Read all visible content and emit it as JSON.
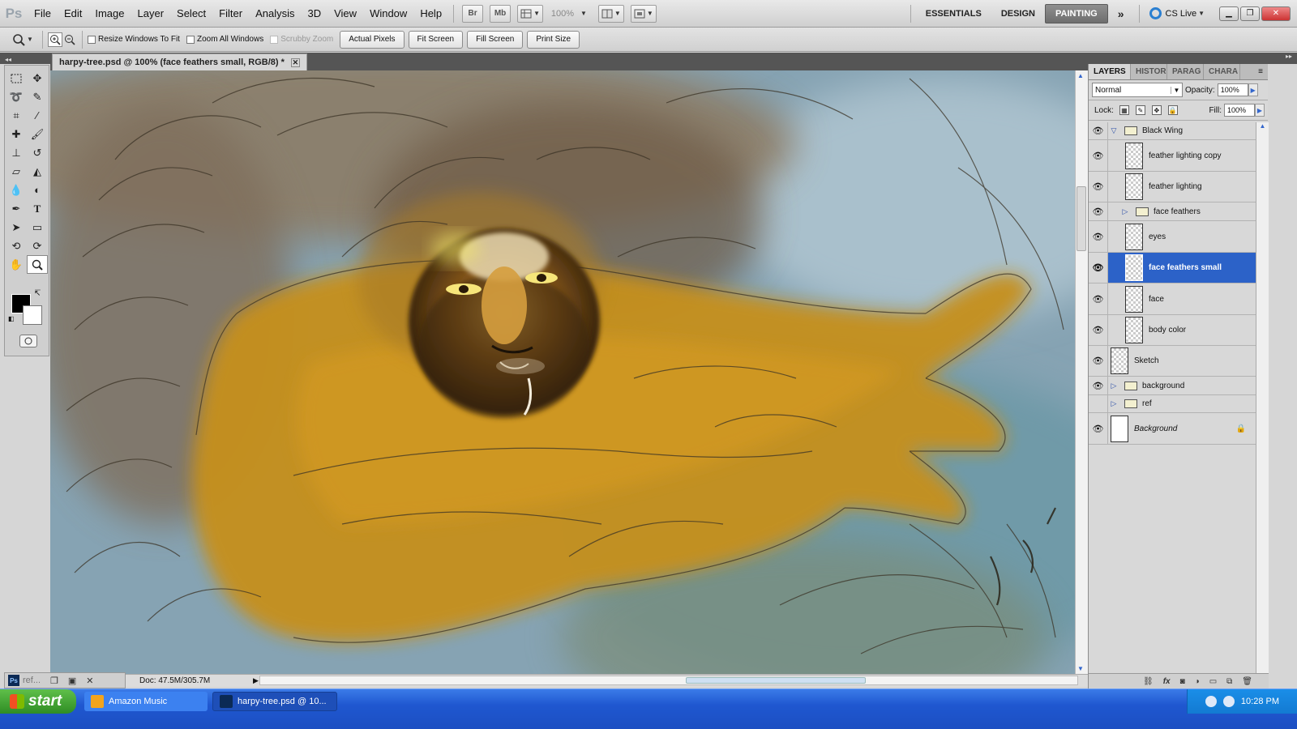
{
  "app": {
    "logo": "Ps"
  },
  "menu": [
    "File",
    "Edit",
    "Image",
    "Layer",
    "Select",
    "Filter",
    "Analysis",
    "3D",
    "View",
    "Window",
    "Help"
  ],
  "appbar": {
    "bridge_label": "Br",
    "minibridge_label": "Mb",
    "zoom": "100%",
    "workspaces": [
      "ESSENTIALS",
      "DESIGN",
      "PAINTING"
    ],
    "active_workspace": "PAINTING",
    "cslive": "CS Live"
  },
  "options": {
    "resize_windows": "Resize Windows To Fit",
    "zoom_all": "Zoom All Windows",
    "scrubby_zoom": "Scrubby Zoom",
    "buttons": [
      "Actual Pixels",
      "Fit Screen",
      "Fill Screen",
      "Print Size"
    ]
  },
  "document": {
    "tab_title": "harpy-tree.psd @ 100% (face feathers small, RGB/8) *",
    "doc_size": "Doc: 47.5M/305.7M",
    "minimized_title": "ref..."
  },
  "layers_panel": {
    "tabs": [
      "LAYERS",
      "HISTOR",
      "PARAG",
      "CHARA"
    ],
    "blend_mode": "Normal",
    "opacity_label": "Opacity:",
    "opacity": "100%",
    "lock_label": "Lock:",
    "fill_label": "Fill:",
    "fill": "100%",
    "layers": [
      {
        "name": "Black Wing",
        "type": "group",
        "expanded": true,
        "indent": 0,
        "visible": true
      },
      {
        "name": "feather lighting copy",
        "type": "layer",
        "indent": 1,
        "visible": true
      },
      {
        "name": "feather lighting",
        "type": "layer",
        "indent": 1,
        "visible": true
      },
      {
        "name": "face feathers",
        "type": "group",
        "expanded": false,
        "indent": 1,
        "visible": true
      },
      {
        "name": "eyes",
        "type": "layer",
        "indent": 1,
        "visible": true
      },
      {
        "name": "face feathers small",
        "type": "layer",
        "indent": 1,
        "visible": true,
        "selected": true
      },
      {
        "name": "face",
        "type": "layer",
        "indent": 1,
        "visible": true
      },
      {
        "name": "body color",
        "type": "layer",
        "indent": 1,
        "visible": true
      },
      {
        "name": "Sketch",
        "type": "layer",
        "indent": 0,
        "visible": true
      },
      {
        "name": "background",
        "type": "group",
        "expanded": false,
        "indent": 0,
        "visible": true
      },
      {
        "name": "ref",
        "type": "group",
        "expanded": false,
        "indent": 0,
        "visible": false
      },
      {
        "name": "Background",
        "type": "background",
        "indent": 0,
        "visible": true,
        "locked": true
      }
    ]
  },
  "taskbar": {
    "start": "start",
    "items": [
      "Amazon Music",
      "harpy-tree.psd @ 10..."
    ],
    "clock": "10:28 PM"
  },
  "colors": {
    "selection": "#2c62c8",
    "workspace_active": "#7a7a7a",
    "taskbar": "#245edb",
    "start": "#3c9a2e"
  }
}
